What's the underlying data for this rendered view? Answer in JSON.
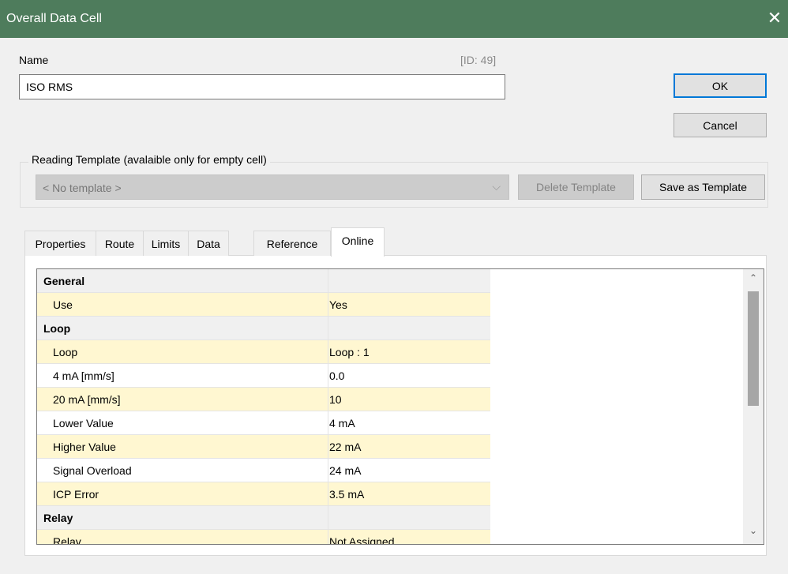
{
  "window": {
    "title": "Overall Data Cell",
    "close_glyph": "✕"
  },
  "name_section": {
    "label": "Name",
    "id_text": "[ID: 49]",
    "value": "ISO RMS"
  },
  "buttons": {
    "ok": "OK",
    "cancel": "Cancel",
    "delete_template": "Delete Template",
    "save_template": "Save as Template"
  },
  "template": {
    "legend": "Reading Template (avalaible only for empty cell)",
    "selected": "< No template >",
    "arrow": "⌵"
  },
  "tabs": [
    "Properties",
    "Route",
    "Limits",
    "Data",
    "Reference",
    "Online"
  ],
  "active_tab": "Online",
  "grid": {
    "rows": [
      {
        "key": "General",
        "value": ""
      },
      {
        "key": "Use",
        "value": "Yes"
      },
      {
        "key": "Loop",
        "value": ""
      },
      {
        "key": "Loop",
        "value": "Loop : 1"
      },
      {
        "key": "4 mA [mm/s]",
        "value": "0.0"
      },
      {
        "key": "20 mA [mm/s]",
        "value": "10"
      },
      {
        "key": "Lower Value",
        "value": "4 mA"
      },
      {
        "key": "Higher Value",
        "value": "22 mA"
      },
      {
        "key": "Signal Overload",
        "value": "24 mA"
      },
      {
        "key": "ICP Error",
        "value": "3.5 mA"
      },
      {
        "key": "Relay",
        "value": ""
      },
      {
        "key": "Relay",
        "value": "Not Assigned"
      }
    ],
    "scroll_up": "⌃",
    "scroll_down": "⌄"
  }
}
